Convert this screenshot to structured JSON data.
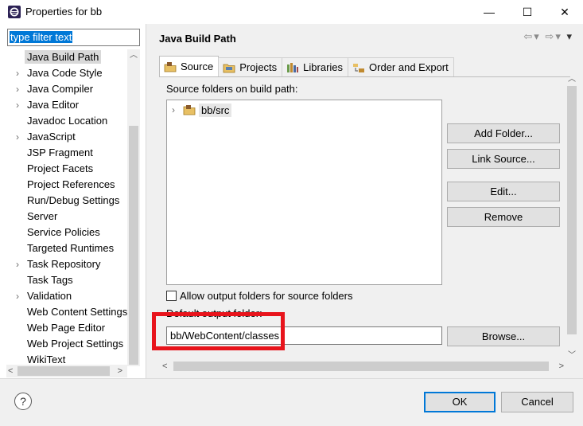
{
  "window": {
    "title": "Properties for bb",
    "minimize": "—",
    "maximize": "☐",
    "close": "✕"
  },
  "filter": {
    "text": "type filter text"
  },
  "tree": {
    "items": [
      {
        "label": "Java Build Path",
        "expandable": false,
        "selected": true
      },
      {
        "label": "Java Code Style",
        "expandable": true
      },
      {
        "label": "Java Compiler",
        "expandable": true
      },
      {
        "label": "Java Editor",
        "expandable": true
      },
      {
        "label": "Javadoc Location",
        "expandable": false
      },
      {
        "label": "JavaScript",
        "expandable": true
      },
      {
        "label": "JSP Fragment",
        "expandable": false
      },
      {
        "label": "Project Facets",
        "expandable": false
      },
      {
        "label": "Project References",
        "expandable": false
      },
      {
        "label": "Run/Debug Settings",
        "expandable": false
      },
      {
        "label": "Server",
        "expandable": false
      },
      {
        "label": "Service Policies",
        "expandable": false
      },
      {
        "label": "Targeted Runtimes",
        "expandable": false
      },
      {
        "label": "Task Repository",
        "expandable": true
      },
      {
        "label": "Task Tags",
        "expandable": false
      },
      {
        "label": "Validation",
        "expandable": true
      },
      {
        "label": "Web Content Settings",
        "expandable": false
      },
      {
        "label": "Web Page Editor",
        "expandable": false
      },
      {
        "label": "Web Project Settings",
        "expandable": false
      },
      {
        "label": "WikiText",
        "expandable": false
      }
    ]
  },
  "page": {
    "title": "Java Build Path",
    "tabs": [
      {
        "label": "Source",
        "icon": "source-folder-icon",
        "active": true
      },
      {
        "label": "Projects",
        "icon": "projects-icon"
      },
      {
        "label": "Libraries",
        "icon": "libraries-icon"
      },
      {
        "label": "Order and Export",
        "icon": "order-export-icon"
      }
    ],
    "source_folders_label": "Source folders on build path:",
    "source_folders": [
      "bb/src"
    ],
    "buttons": {
      "add_folder": "Add Folder...",
      "link_source": "Link Source...",
      "edit": "Edit...",
      "remove": "Remove",
      "browse": "Browse..."
    },
    "allow_output_label": "Allow output folders for source folders",
    "default_output_label": "Default output folder:",
    "default_output_value": "bb/WebContent/classes"
  },
  "footer": {
    "help": "?",
    "ok": "OK",
    "cancel": "Cancel"
  },
  "colors": {
    "highlight": "#e8141c",
    "selection": "#0078d7"
  }
}
